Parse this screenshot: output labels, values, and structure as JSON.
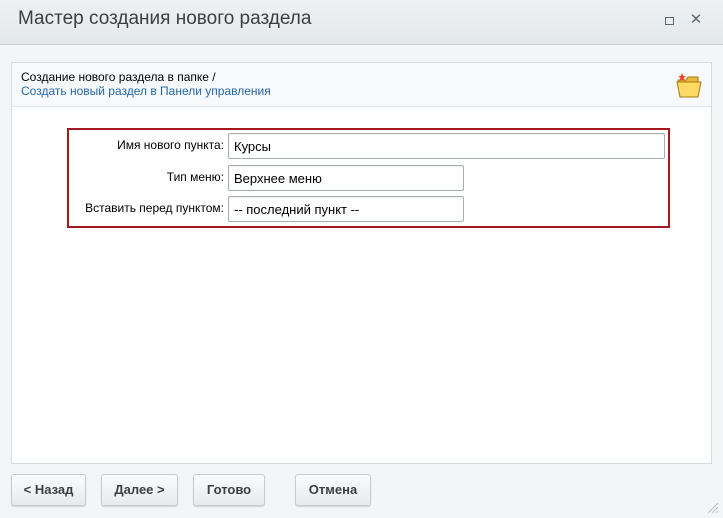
{
  "window": {
    "title": "Мастер создания нового раздела",
    "maximize_icon": "maximize-icon",
    "close_icon": "close-icon",
    "close_glyph": "✕"
  },
  "header": {
    "line1": "Создание нового раздела в папке /",
    "link": "Создать новый раздел в Панели управления",
    "icon": "new-folder-icon"
  },
  "form": {
    "item_name_label": "Имя нового пункта:",
    "item_name_value": "Курсы",
    "menu_type_label": "Тип меню:",
    "menu_type_value": "Верхнее меню",
    "insert_before_label": "Вставить перед пунктом:",
    "insert_before_value": "-- последний пункт --"
  },
  "footer": {
    "back_label": "< Назад",
    "next_label": "Далее >",
    "done_label": "Готово",
    "cancel_label": "Отмена"
  },
  "colors": {
    "highlight_border": "#a4181f",
    "link": "#2467a8"
  }
}
